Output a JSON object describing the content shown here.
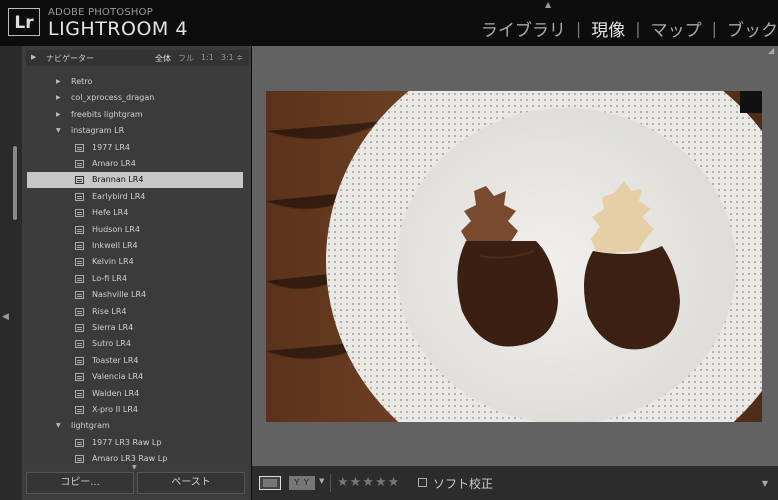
{
  "app": {
    "logo": "Lr",
    "brand_top": "ADOBE PHOTOSHOP",
    "brand_main": "LIGHTROOM 4"
  },
  "modules": [
    {
      "label": "ライブラリ",
      "active": false
    },
    {
      "label": "現像",
      "active": true
    },
    {
      "label": "マップ",
      "active": false
    },
    {
      "label": "ブック",
      "active": false
    }
  ],
  "navigator": {
    "title": "ナビゲーター",
    "zooms": [
      "全体",
      "フル",
      "1:1",
      "3:1 ≑"
    ]
  },
  "presets": [
    {
      "label": "Retro",
      "type": "folder",
      "expanded": false,
      "level": 1
    },
    {
      "label": "col_xprocess_dragan",
      "type": "folder",
      "expanded": false,
      "level": 1
    },
    {
      "label": "freebits lightgram",
      "type": "folder",
      "expanded": false,
      "level": 1
    },
    {
      "label": "instagram LR",
      "type": "folder",
      "expanded": true,
      "level": 1
    },
    {
      "label": "1977 LR4",
      "type": "preset",
      "level": 2
    },
    {
      "label": "Amaro LR4",
      "type": "preset",
      "level": 2
    },
    {
      "label": "Brannan LR4",
      "type": "preset",
      "level": 2,
      "selected": true
    },
    {
      "label": "Earlybird LR4",
      "type": "preset",
      "level": 2
    },
    {
      "label": "Hefe LR4",
      "type": "preset",
      "level": 2
    },
    {
      "label": "Hudson LR4",
      "type": "preset",
      "level": 2
    },
    {
      "label": "Inkwell LR4",
      "type": "preset",
      "level": 2
    },
    {
      "label": "Kelvin LR4",
      "type": "preset",
      "level": 2
    },
    {
      "label": "Lo-fi LR4",
      "type": "preset",
      "level": 2
    },
    {
      "label": "Nashville LR4",
      "type": "preset",
      "level": 2
    },
    {
      "label": "Rise LR4",
      "type": "preset",
      "level": 2
    },
    {
      "label": "Sierra LR4",
      "type": "preset",
      "level": 2
    },
    {
      "label": "Sutro LR4",
      "type": "preset",
      "level": 2
    },
    {
      "label": "Toaster LR4",
      "type": "preset",
      "level": 2
    },
    {
      "label": "Valencia LR4",
      "type": "preset",
      "level": 2
    },
    {
      "label": "Walden LR4",
      "type": "preset",
      "level": 2
    },
    {
      "label": "X-pro II LR4",
      "type": "preset",
      "level": 2
    },
    {
      "label": "lightgram",
      "type": "folder",
      "expanded": true,
      "level": 1
    },
    {
      "label": "1977 LR3 Raw Lp",
      "type": "preset",
      "level": 2
    },
    {
      "label": "Amaro LR3 Raw Lp",
      "type": "preset",
      "level": 2
    }
  ],
  "buttons": {
    "copy": "コピー...",
    "paste": "ペースト"
  },
  "toolbar": {
    "yy": "Y Y",
    "stars": "★★★★★",
    "soft_proof": "ソフト校正"
  },
  "colors": {
    "selected_row": "#c7c7c7",
    "panel": "#3c3c3c",
    "center_bg": "#626262"
  }
}
